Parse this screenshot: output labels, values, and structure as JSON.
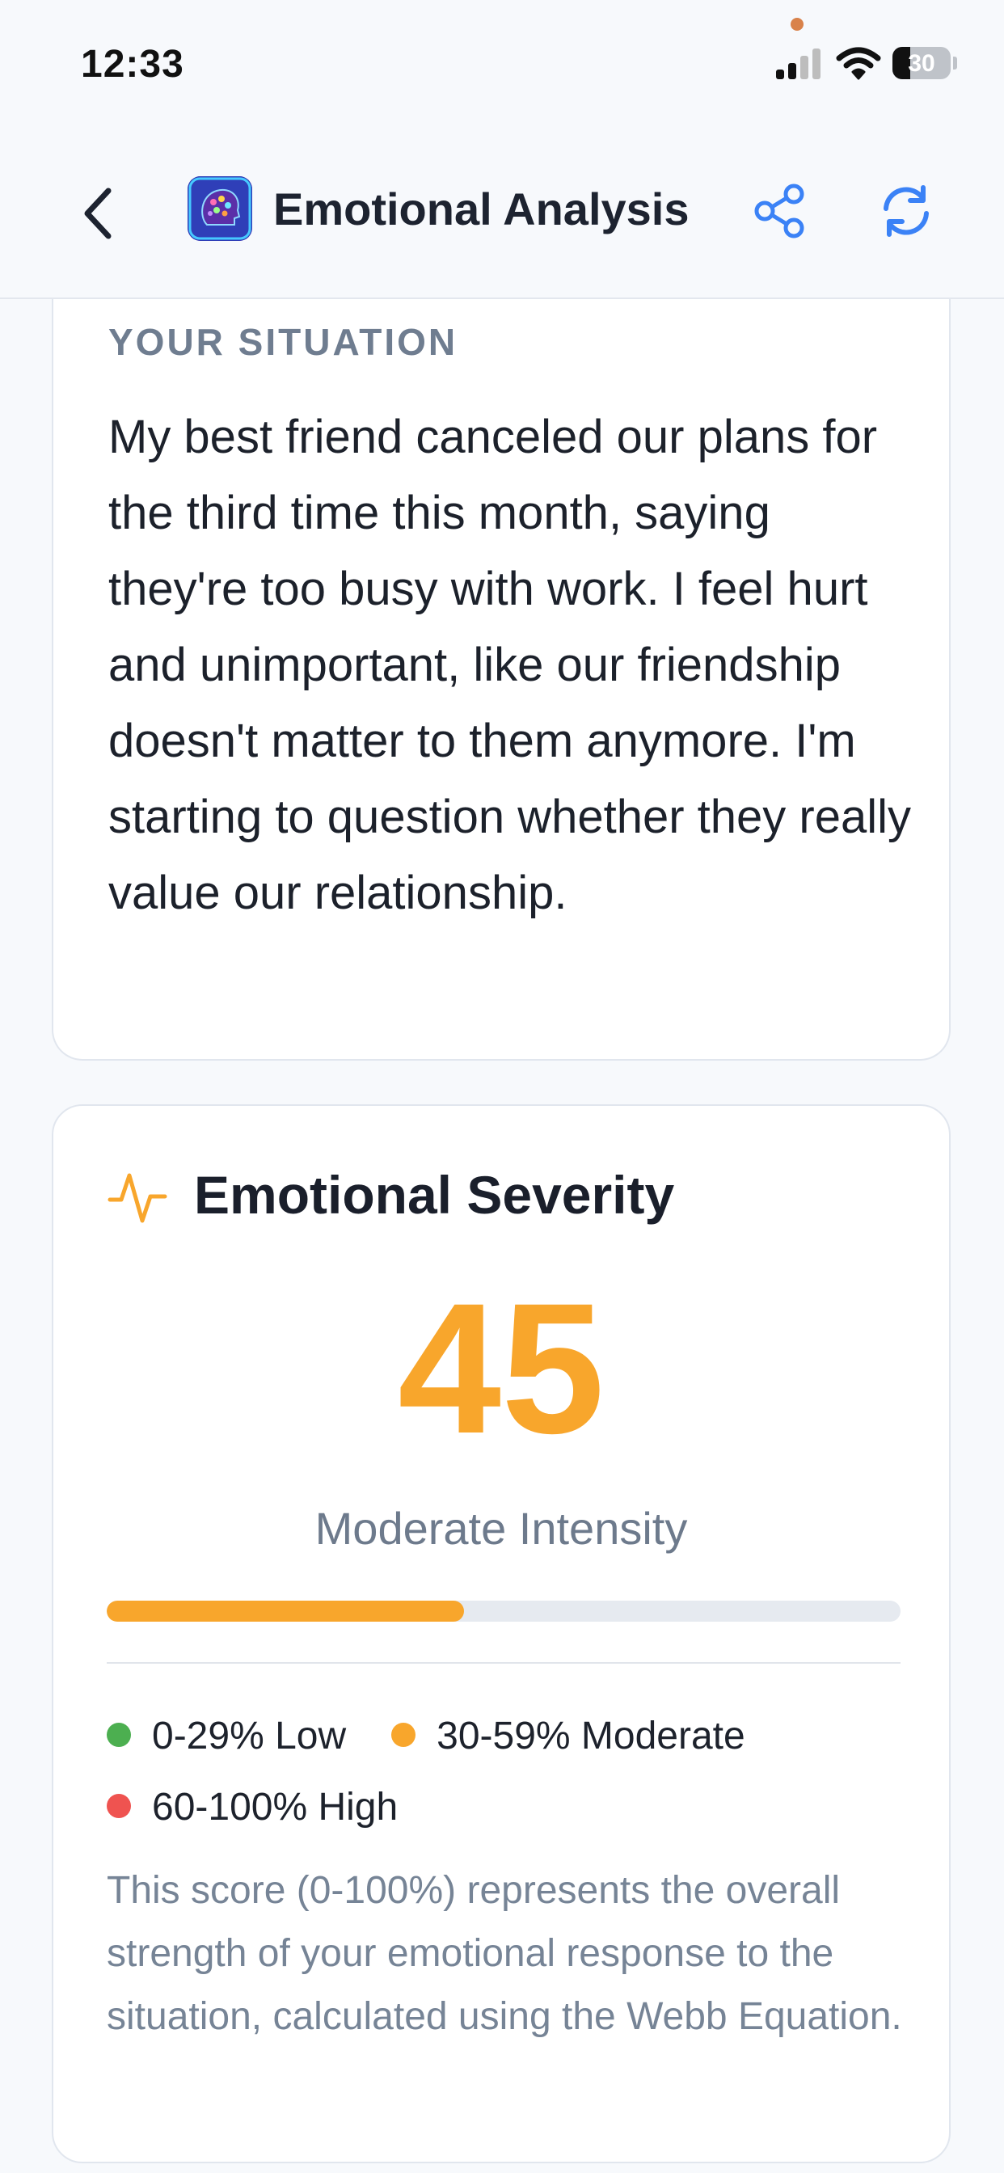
{
  "status_bar": {
    "time": "12:33",
    "battery_level": "30",
    "battery_fraction": 0.3
  },
  "nav": {
    "title": "Emotional Analysis",
    "icons": {
      "back": "chevron-left-icon",
      "logo": "app-logo",
      "share": "share-icon",
      "refresh": "refresh-icon"
    },
    "accent_color": "#3b82f6"
  },
  "situation": {
    "heading": "YOUR SITUATION",
    "text": "My best friend canceled our plans for the third time this month, saying they're too busy with work. I feel hurt and unimportant, like our friendship doesn't matter to them anymore. I'm starting to question whether they really value our relationship."
  },
  "severity": {
    "title": "Emotional Severity",
    "icon": "pulse-icon",
    "score": "45",
    "score_fraction": 0.45,
    "label": "Moderate Intensity",
    "score_color": "#f8a62c",
    "legend": [
      {
        "label": "0-29% Low",
        "color": "#4caf50"
      },
      {
        "label": "30-59% Moderate",
        "color": "#f8a62c"
      },
      {
        "label": "60-100% High",
        "color": "#ef5350"
      }
    ],
    "explanation": "This score (0-100%) represents the overall strength of your emotional response to the situation, calculated using the Webb Equation."
  }
}
